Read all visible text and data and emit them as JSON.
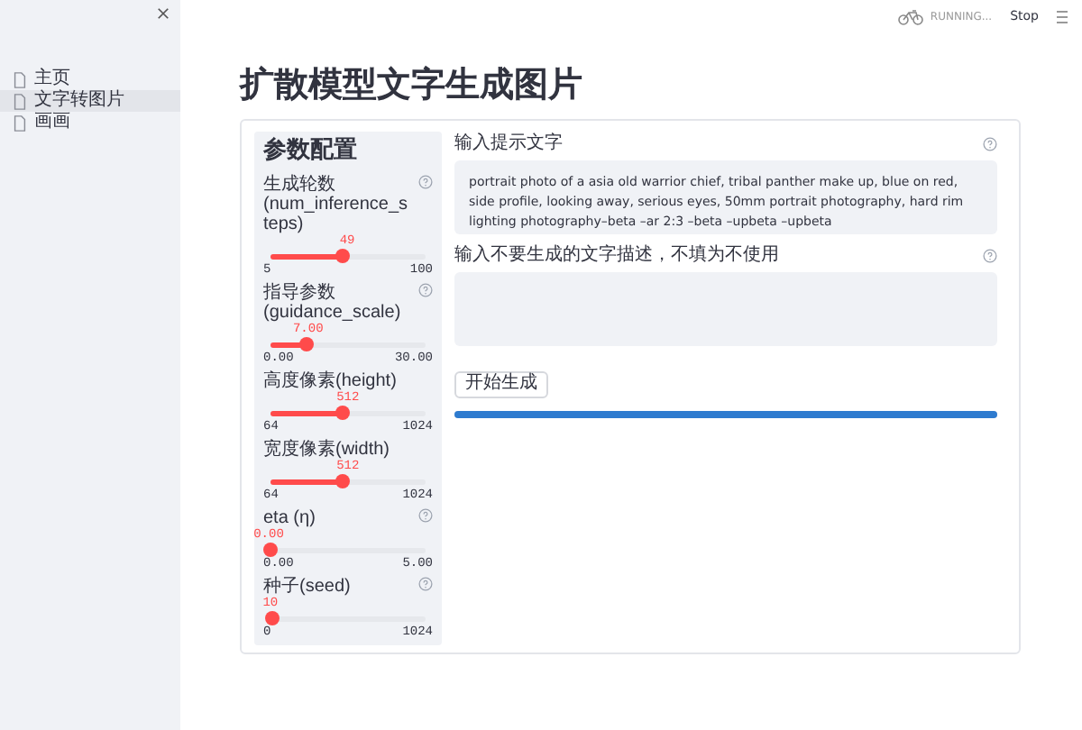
{
  "sidebar": {
    "items": [
      {
        "label": "主页",
        "selected": false
      },
      {
        "label": "文字转图片",
        "selected": true
      },
      {
        "label": "画画",
        "selected": false
      }
    ]
  },
  "status": {
    "text": "RUNNING...",
    "stop": "Stop"
  },
  "title": "扩散模型文字生成图片",
  "params": {
    "heading": "参数配置",
    "sliders": [
      {
        "label": "生成轮数(num_inference_steps)",
        "value": "49",
        "min": "5",
        "max": "100",
        "level": 0.463,
        "help": true
      },
      {
        "label": "指导参数(guidance_scale)",
        "value": "7.00",
        "min": "0.00",
        "max": "30.00",
        "level": 0.233,
        "help": true
      },
      {
        "label": "高度像素(height)",
        "value": "512",
        "min": "64",
        "max": "1024",
        "level": 0.467,
        "help": false
      },
      {
        "label": "宽度像素(width)",
        "value": "512",
        "min": "64",
        "max": "1024",
        "level": 0.467,
        "help": false
      },
      {
        "label": "eta (η)",
        "value": "0.00",
        "min": "0.00",
        "max": "5.00",
        "level": 0,
        "help": true
      },
      {
        "label": "种子(seed)",
        "value": "10",
        "min": "0",
        "max": "1024",
        "level": 0.01,
        "help": true
      }
    ]
  },
  "prompt": {
    "label": "输入提示文字",
    "value": "portrait photo of a asia old warrior chief, tribal panther make up, blue on red, side profile, looking away, serious eyes, 50mm portrait photography, hard rim lighting photography–beta –ar 2:3 –beta –upbeta –upbeta"
  },
  "negative": {
    "label": "输入不要生成的文字描述，不填为不使用"
  },
  "button": "开始生成",
  "progress": {
    "level": 1
  }
}
